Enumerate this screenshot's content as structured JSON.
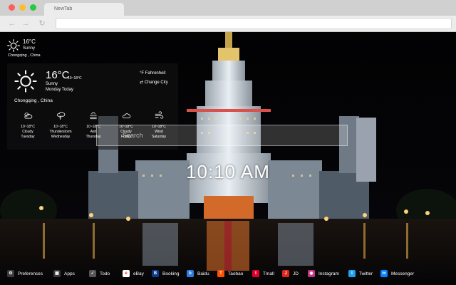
{
  "browser": {
    "tab_title": "NewTab",
    "nav": {
      "back_icon": "back-arrow-icon",
      "forward_icon": "forward-arrow-icon",
      "reload_icon": "reload-icon"
    }
  },
  "mini_weather": {
    "temp": "16°C",
    "condition": "Sunny",
    "city": "Chongqing , China",
    "icon": "sun-icon"
  },
  "weather_panel": {
    "temp": "16°C",
    "range": "10~18°C",
    "condition": "Sunny",
    "day": "Monday Today",
    "city": "Chongqing , China",
    "option_units": "Fahrenheit",
    "option_city": "Change City",
    "forecast": [
      {
        "range": "10~18°C",
        "condition": "Cloudy",
        "day": "Tuesday",
        "icon": "cloudy-icon"
      },
      {
        "range": "10~18°C",
        "condition": "Thunderstorm",
        "day": "Wednesday",
        "icon": "thunderstorm-icon"
      },
      {
        "range": "10~18°C",
        "condition": "Ash",
        "day": "Thursday",
        "icon": "ash-icon"
      },
      {
        "range": "10~18°C",
        "condition": "Cloudy",
        "day": "Friday",
        "icon": "cloud-icon"
      },
      {
        "range": "10~18°C",
        "condition": "Wind",
        "day": "Saturday",
        "icon": "wind-icon"
      }
    ]
  },
  "search": {
    "placeholder": "Search"
  },
  "clock": {
    "time": "10:10 AM"
  },
  "bottom_bar": {
    "items": [
      {
        "label": "Preferences",
        "icon": "gear-icon",
        "color": "#3a3a3a"
      },
      {
        "label": "Apps",
        "icon": "apps-grid-icon",
        "color": "#3a3a3a"
      },
      {
        "label": "Todo",
        "icon": "todo-icon",
        "color": "#555555"
      },
      {
        "label": "eBay",
        "icon": "ebay-icon",
        "color": "#ffffff"
      },
      {
        "label": "Booking",
        "icon": "booking-icon",
        "color": "#0b3b8c"
      },
      {
        "label": "Baidu",
        "icon": "baidu-icon",
        "color": "#2d7de2"
      },
      {
        "label": "Taobao",
        "icon": "taobao-icon",
        "color": "#ff5000"
      },
      {
        "label": "Tmall",
        "icon": "tmall-icon",
        "color": "#e0002a"
      },
      {
        "label": "JD",
        "icon": "jd-icon",
        "color": "#e1251b"
      },
      {
        "label": "Instagram",
        "icon": "instagram-icon",
        "color": "#c13584"
      },
      {
        "label": "Twitter",
        "icon": "twitter-icon",
        "color": "#1da1f2"
      },
      {
        "label": "Messenger",
        "icon": "messenger-icon",
        "color": "#0084ff"
      }
    ]
  }
}
